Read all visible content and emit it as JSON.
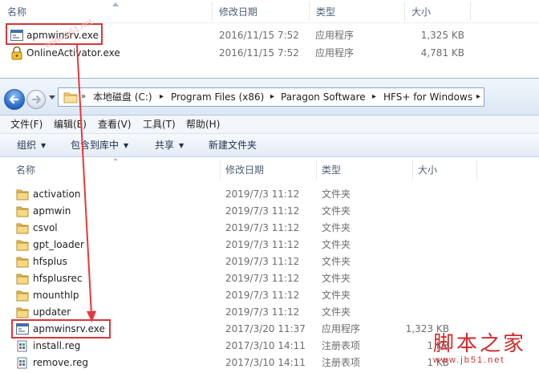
{
  "top_window": {
    "columns": {
      "name": "名称",
      "date": "修改日期",
      "type": "类型",
      "size": "大小"
    },
    "files": [
      {
        "name": "apmwinsrv.exe",
        "date": "2016/11/15 7:52",
        "type": "应用程序",
        "size": "1,325 KB",
        "icon": "exe-icon"
      },
      {
        "name": "OnlineActivator.exe",
        "date": "2016/11/15 7:52",
        "type": "应用程序",
        "size": "4,781 KB",
        "icon": "lock-exe-icon"
      }
    ]
  },
  "address_bar": {
    "segments": [
      "本地磁盘 (C:)",
      "Program Files (x86)",
      "Paragon Software",
      "HFS+ for Windows"
    ]
  },
  "menu": {
    "items": [
      "文件(F)",
      "编辑(E)",
      "查看(V)",
      "工具(T)",
      "帮助(H)"
    ]
  },
  "toolbar": {
    "organize": "组织",
    "include_library": "包含到库中",
    "share": "共享",
    "new_folder": "新建文件夹"
  },
  "columns": {
    "name": "名称",
    "date": "修改日期",
    "type": "类型",
    "size": "大小"
  },
  "rows": [
    {
      "name": "activation",
      "date": "2019/7/3 11:12",
      "type": "文件夹",
      "size": "",
      "icon": "folder-icon"
    },
    {
      "name": "apmwin",
      "date": "2019/7/3 11:12",
      "type": "文件夹",
      "size": "",
      "icon": "folder-icon"
    },
    {
      "name": "csvol",
      "date": "2019/7/3 11:12",
      "type": "文件夹",
      "size": "",
      "icon": "folder-icon"
    },
    {
      "name": "gpt_loader",
      "date": "2019/7/3 11:12",
      "type": "文件夹",
      "size": "",
      "icon": "folder-icon"
    },
    {
      "name": "hfsplus",
      "date": "2019/7/3 11:12",
      "type": "文件夹",
      "size": "",
      "icon": "folder-icon"
    },
    {
      "name": "hfsplusrec",
      "date": "2019/7/3 11:12",
      "type": "文件夹",
      "size": "",
      "icon": "folder-icon"
    },
    {
      "name": "mounthlp",
      "date": "2019/7/3 11:12",
      "type": "文件夹",
      "size": "",
      "icon": "folder-icon"
    },
    {
      "name": "updater",
      "date": "2019/7/3 11:12",
      "type": "文件夹",
      "size": "",
      "icon": "folder-icon"
    },
    {
      "name": "apmwinsrv.exe",
      "date": "2017/3/20 11:37",
      "type": "应用程序",
      "size": "1,323 KB",
      "icon": "exe-icon"
    },
    {
      "name": "install.reg",
      "date": "2017/3/10 14:11",
      "type": "注册表项",
      "size": "1 KB",
      "icon": "reg-icon"
    },
    {
      "name": "remove.reg",
      "date": "2017/3/10 14:11",
      "type": "注册表项",
      "size": "1 KB",
      "icon": "reg-icon"
    }
  ],
  "watermark": {
    "text": "www.jb51.net"
  },
  "logo": {
    "cn": "脚本之家",
    "url": "www.jb51.net"
  },
  "colors": {
    "highlight": "#d9373b",
    "arrow": "#e8373b",
    "logo": "#d02c2c"
  }
}
